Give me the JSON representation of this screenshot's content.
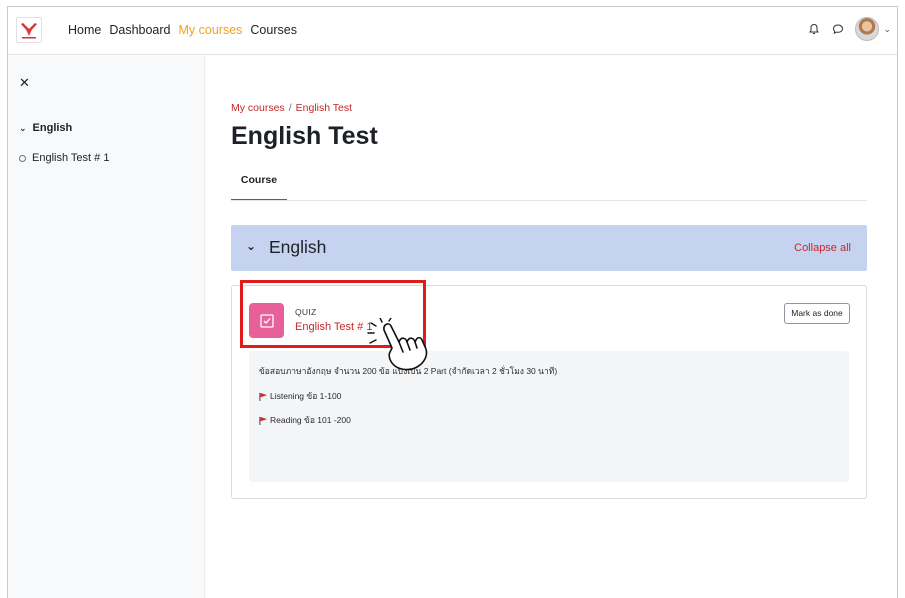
{
  "navbar": {
    "links": [
      "Home",
      "Dashboard",
      "My courses",
      "Courses"
    ],
    "active": "My courses",
    "icons": [
      "bell-icon",
      "chat-icon"
    ]
  },
  "sidebar": {
    "section_label": "English",
    "items": [
      {
        "label": "English Test # 1"
      }
    ]
  },
  "breadcrumb": {
    "items": [
      "My courses",
      "English Test"
    ]
  },
  "page": {
    "title": "English Test"
  },
  "tabs": [
    {
      "label": "Course"
    }
  ],
  "section": {
    "title": "English",
    "collapse_label": "Collapse all"
  },
  "activity": {
    "type_label": "QUIZ",
    "name": "English Test # 1",
    "mark_done_label": "Mark as done",
    "description": {
      "line1": "ข้อสอบภาษาอังกฤษ จำนวน 200 ข้อ แบ่งเป็น 2 Part (จำกัดเวลา 2 ชั่วโมง 30 นาที)",
      "part1": "Listening ข้อ 1-100",
      "part2": "Reading ข้อ 101 -200"
    }
  },
  "colors": {
    "accent": "#c62828",
    "active_nav": "#f0a020",
    "section_bg": "#c5d3f0",
    "quiz_icon": "#e8609a",
    "highlight": "#e01b1b"
  }
}
